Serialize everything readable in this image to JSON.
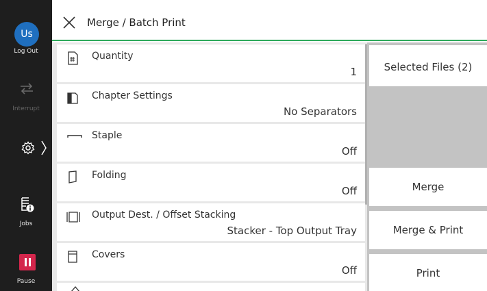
{
  "sidebar": {
    "user_avatar": "Us",
    "logout_label": "Log Out",
    "interrupt_label": "Interrupt",
    "jobs_label": "Jobs",
    "pause_label": "Pause"
  },
  "header": {
    "title": "Merge / Batch Print"
  },
  "list": {
    "items": [
      {
        "label": "Quantity",
        "value": "1",
        "icon": "quantity-icon"
      },
      {
        "label": "Chapter Settings",
        "value": "No Separators",
        "icon": "chapter-icon"
      },
      {
        "label": "Staple",
        "value": "Off",
        "icon": "staple-icon"
      },
      {
        "label": "Folding",
        "value": "Off",
        "icon": "folding-icon"
      },
      {
        "label": "Output Dest. / Offset Stacking",
        "value": "Stacker - Top Output Tray",
        "icon": "output-icon"
      },
      {
        "label": "Covers",
        "value": "Off",
        "icon": "covers-icon"
      }
    ]
  },
  "actions": {
    "selected_files": "Selected Files (2)",
    "merge": "Merge",
    "merge_print": "Merge & Print",
    "print": "Print"
  },
  "colors": {
    "accent_green": "#2eaa5c",
    "pause_red": "#d4264c",
    "avatar_blue": "#1f6fbf"
  }
}
